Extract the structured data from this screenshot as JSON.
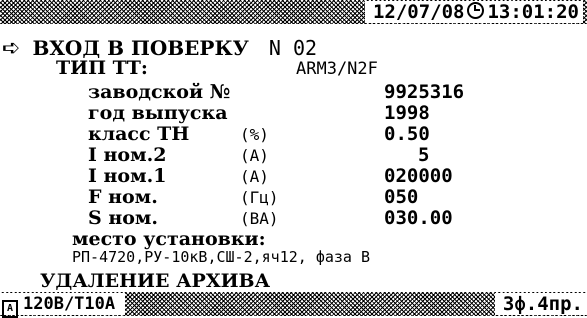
{
  "status_bar": {
    "date": "12/07/08",
    "time": "13:01:20",
    "clock_icon": "clock-icon"
  },
  "screen": {
    "title_prefix": "ВХОД В ПОВЕРКУ",
    "title_number": "N 02",
    "tt_type_label": "ТИП ТТ:",
    "tt_type_value": "ARM3/N2F",
    "fields": [
      {
        "label": "заводской №",
        "unit": "",
        "value": "9925316"
      },
      {
        "label": "год выпуска",
        "unit": "",
        "value": "1998"
      },
      {
        "label": "класс ТН",
        "unit": "(%)",
        "value": "0.50"
      },
      {
        "label": "I ном.2",
        "unit": "(А)",
        "value": "5"
      },
      {
        "label": "I ном.1",
        "unit": "(А)",
        "value": "020000"
      },
      {
        "label": "F ном.",
        "unit": "(Гц)",
        "value": "050"
      },
      {
        "label": "S ном.",
        "unit": "(ВА)",
        "value": "030.00"
      }
    ],
    "location_label": "место установки:",
    "location_value": "РП-4720,РУ-10кВ,СШ-2,яч12, фаза В",
    "delete_archive": "УДАЛЕНИЕ АРХИВА"
  },
  "bottom_bar": {
    "left": "120В/Т10А",
    "right": "3ф.4пр.",
    "archive_icon": "archive-icon"
  }
}
